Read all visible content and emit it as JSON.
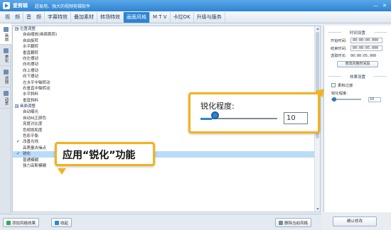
{
  "app": {
    "name": "爱剪辑",
    "slogan": "超易用、强大的视频剪辑软件",
    "min": "—",
    "close": "✕"
  },
  "menu": {
    "items": [
      "视　频",
      "音　频",
      "字幕特效",
      "叠加素材",
      "转场特效",
      "画面风格",
      "M T V",
      "卡拉OK",
      "升级与服务"
    ],
    "active_index": 5
  },
  "left_tabs": [
    "画面",
    "美化",
    "滤镜",
    "动景"
  ],
  "tree": {
    "groups": [
      {
        "label": "位置调整",
        "items": [
          {
            "label": "自由缩放(画面裁剪)",
            "checked": false
          },
          {
            "label": "自由旋转",
            "checked": false
          },
          {
            "label": "水平翻转",
            "checked": false
          },
          {
            "label": "垂直翻转",
            "checked": false
          },
          {
            "label": "向左摆动",
            "checked": false
          },
          {
            "label": "向右摆动",
            "checked": false
          },
          {
            "label": "向上摆动",
            "checked": false
          },
          {
            "label": "向下摆动",
            "checked": false
          },
          {
            "label": "左水平中轴转动",
            "checked": false
          },
          {
            "label": "右垂直中轴转动",
            "checked": false
          },
          {
            "label": "水平斜料",
            "checked": false
          },
          {
            "label": "垂直斜料",
            "checked": false
          }
        ]
      },
      {
        "label": "画面调整",
        "items": [
          {
            "label": "自动曝光",
            "checked": false
          },
          {
            "label": "自动纠正颜色",
            "checked": false
          },
          {
            "label": "亮度对比度",
            "checked": false
          },
          {
            "label": "色相饱和度",
            "checked": false
          },
          {
            "label": "色彩平衡",
            "checked": false
          },
          {
            "label": "改善光线",
            "checked": true
          },
          {
            "label": "高质量去噪点",
            "checked": false
          },
          {
            "label": "锐化",
            "checked": true,
            "selected": true
          },
          {
            "label": "普通模糊",
            "checked": false
          },
          {
            "label": "强力高斯模糊",
            "checked": false
          }
        ]
      }
    ]
  },
  "bottom": {
    "add_label": "添加风格效果",
    "collect_label": "收起",
    "delete_label": "删除当前风格",
    "confirm_label": "确认修改"
  },
  "settings": {
    "time_title": "时间设置",
    "start_label": "开始时间:",
    "start_value": "00:00:00.000",
    "end_label": "结束时间:",
    "end_value": "00:00:05.000",
    "duration_label": "选取时长:",
    "duration_value": "00:00:05.000",
    "modify_time_btn": "修改风格时间段",
    "effect_title": "效果设置",
    "soft_label": "柔和过渡",
    "sharpen_label": "锐化程度:",
    "sharpen_value": "10",
    "sharpen_fraction": 0.1
  },
  "callouts": {
    "sharpen_label": "锐化程度:",
    "sharpen_value": "10",
    "function_text": "应用“锐化”功能"
  },
  "colors": {
    "accent": "#2f84d2",
    "callout": "#f4b21b",
    "selected_row": "#b9dcf7"
  }
}
